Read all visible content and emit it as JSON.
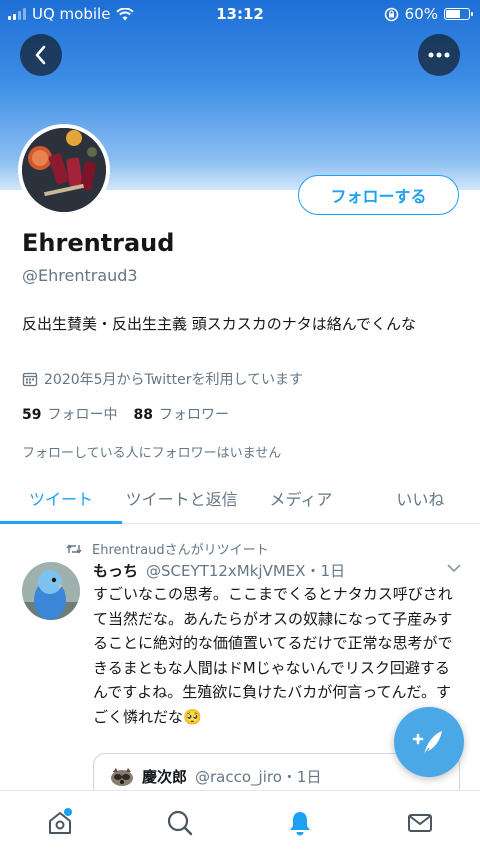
{
  "status_bar": {
    "carrier": "UQ mobile",
    "time": "13:12",
    "battery": "60%",
    "battery_level": 0.6
  },
  "header": {
    "back_icon": "chevron-left-icon",
    "more_icon": "more-horizontal-icon",
    "banner_color": "#2a7fe0"
  },
  "profile": {
    "name": "Ehrentraud",
    "handle": "@Ehrentraud3",
    "follow_label": "フォローする",
    "bio": "反出生賛美・反出生主義 頭スカスカのナタは絡んでくんな",
    "joined": "2020年5月からTwitterを利用しています",
    "following_count": "59",
    "following_label": "フォロー中",
    "followers_count": "88",
    "followers_label": "フォロワー",
    "no_followers_note": "フォローしている人にフォロワーはいません"
  },
  "tabs": [
    {
      "label": "ツイート",
      "active": true
    },
    {
      "label": "ツイートと返信",
      "active": false
    },
    {
      "label": "メディア",
      "active": false
    },
    {
      "label": "いいね",
      "active": false
    }
  ],
  "tweet": {
    "retweet_line": "Ehrentraudさんがリツイート",
    "author_name": "もっち",
    "author_meta": "@SCEYT12xMkjVMEX・1日",
    "text": "すごいなこの思考。ここまでくるとナタカス呼びされて当然だな。あんたらがオスの奴隷になって子産みすることに絶対的な価値置いてるだけで正常な思考ができるまともな人間はドMじゃないんでリスク回避するんですよね。生殖欲に負けたバカが何言ってんだ。すごく憐れだな🥺",
    "quote": {
      "author_name": "慶次郎",
      "author_meta": "@racco_jiro・1日"
    }
  },
  "colors": {
    "accent": "#1da1f2",
    "secondary_text": "#657786"
  },
  "bottom_nav": [
    "home-icon",
    "search-icon",
    "notifications-icon",
    "messages-icon"
  ]
}
